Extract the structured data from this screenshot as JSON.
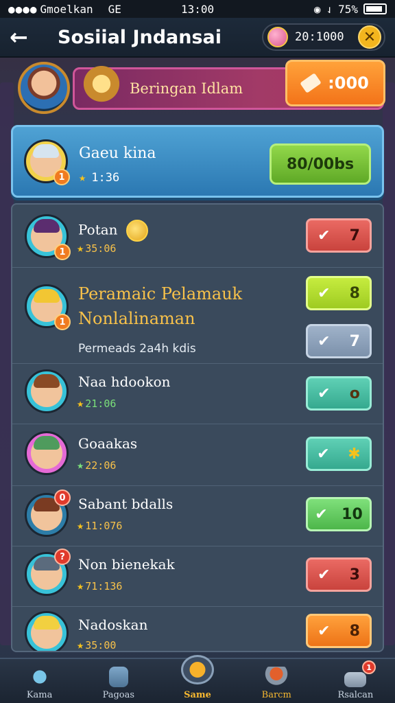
{
  "status_bar": {
    "signal": "●●●●",
    "carrier": "Gmoelkan",
    "network": "GE",
    "time": "13:00",
    "battery": "75%"
  },
  "header": {
    "back_icon": "arrow-left-icon",
    "title": "Sosiial Jndansai",
    "coins": "20:1000",
    "close_icon": "close-icon"
  },
  "promo": {
    "label": "Beringan Idlam",
    "button_value": ":000"
  },
  "featured": {
    "name": "Gaeu kina",
    "score": "1:36",
    "button_label": "80/00bs"
  },
  "rows": [
    {
      "name": "Potan",
      "score": "35:06",
      "action_value": "7",
      "badge": "1"
    },
    {
      "name": "Peramaic Pelamauk Nonlalinaman",
      "sub": "Permeads 2a4h kdis",
      "action_value": "8",
      "action2_value": "7",
      "badge": "1"
    },
    {
      "name": "Naa hdookon",
      "score": "21:06",
      "action_value": "o"
    },
    {
      "name": "Goaakas",
      "score": "22:06",
      "action_value": "✱"
    },
    {
      "name": "Sabant bdalls",
      "score": "11:076",
      "action_value": "10",
      "badge": "0"
    },
    {
      "name": "Non bienekak",
      "score": "71:136",
      "action_value": "3",
      "badge": "?"
    },
    {
      "name": "Nadoskan",
      "score": "35:00",
      "action_value": "8"
    }
  ],
  "nav": [
    {
      "label": "Kama"
    },
    {
      "label": "Pagoas"
    },
    {
      "label": "Same"
    },
    {
      "label": "Barcm"
    },
    {
      "label": "Rsalcan",
      "badge": "1"
    }
  ]
}
